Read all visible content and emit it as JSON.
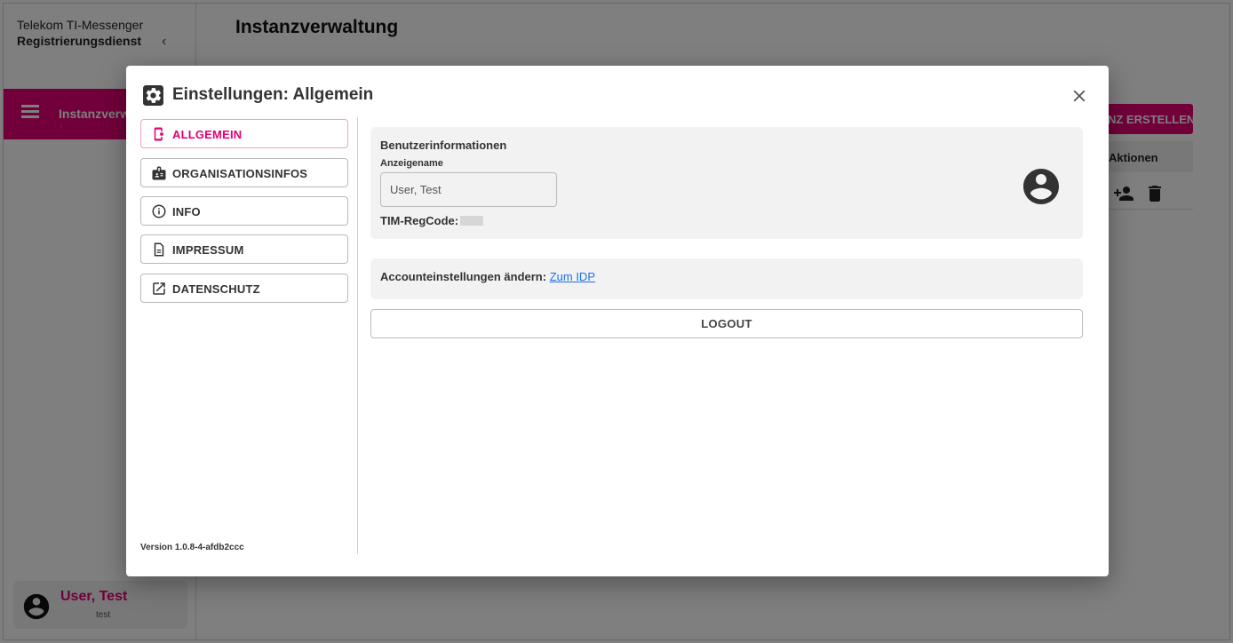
{
  "app": {
    "brand_line1": "Telekom TI-Messenger",
    "brand_line2": "Registrierungsdienst",
    "page_title": "Instanzverwaltung",
    "nav_active_label": "Instanzverwaltung",
    "create_button_label": "INSTANZ ERSTELLEN",
    "table_header": "Aktionen",
    "user": {
      "name": "User, Test",
      "login": "test"
    },
    "brand_color": "#e20074"
  },
  "dialog": {
    "title": "Einstellungen: Allgemein",
    "menu": [
      {
        "label": "ALLGEMEIN",
        "icon": "settings-phone-icon",
        "active": true
      },
      {
        "label": "ORGANISATIONSINFOS",
        "icon": "badge-icon",
        "active": false
      },
      {
        "label": "INFO",
        "icon": "info-icon",
        "active": false
      },
      {
        "label": "IMPRESSUM",
        "icon": "document-icon",
        "active": false
      },
      {
        "label": "DATENSCHUTZ",
        "icon": "open-in-new-icon",
        "active": false
      }
    ],
    "version": "Version 1.0.8-4-afdb2ccc",
    "user_info": {
      "section_title": "Benutzerinformationen",
      "display_name_label": "Anzeigename",
      "display_name_value": "User, Test",
      "regcode_label": "TIM-RegCode:"
    },
    "account": {
      "text": "Accounteinstellungen ändern:",
      "link_label": "Zum IDP"
    },
    "logout_label": "LOGOUT"
  }
}
